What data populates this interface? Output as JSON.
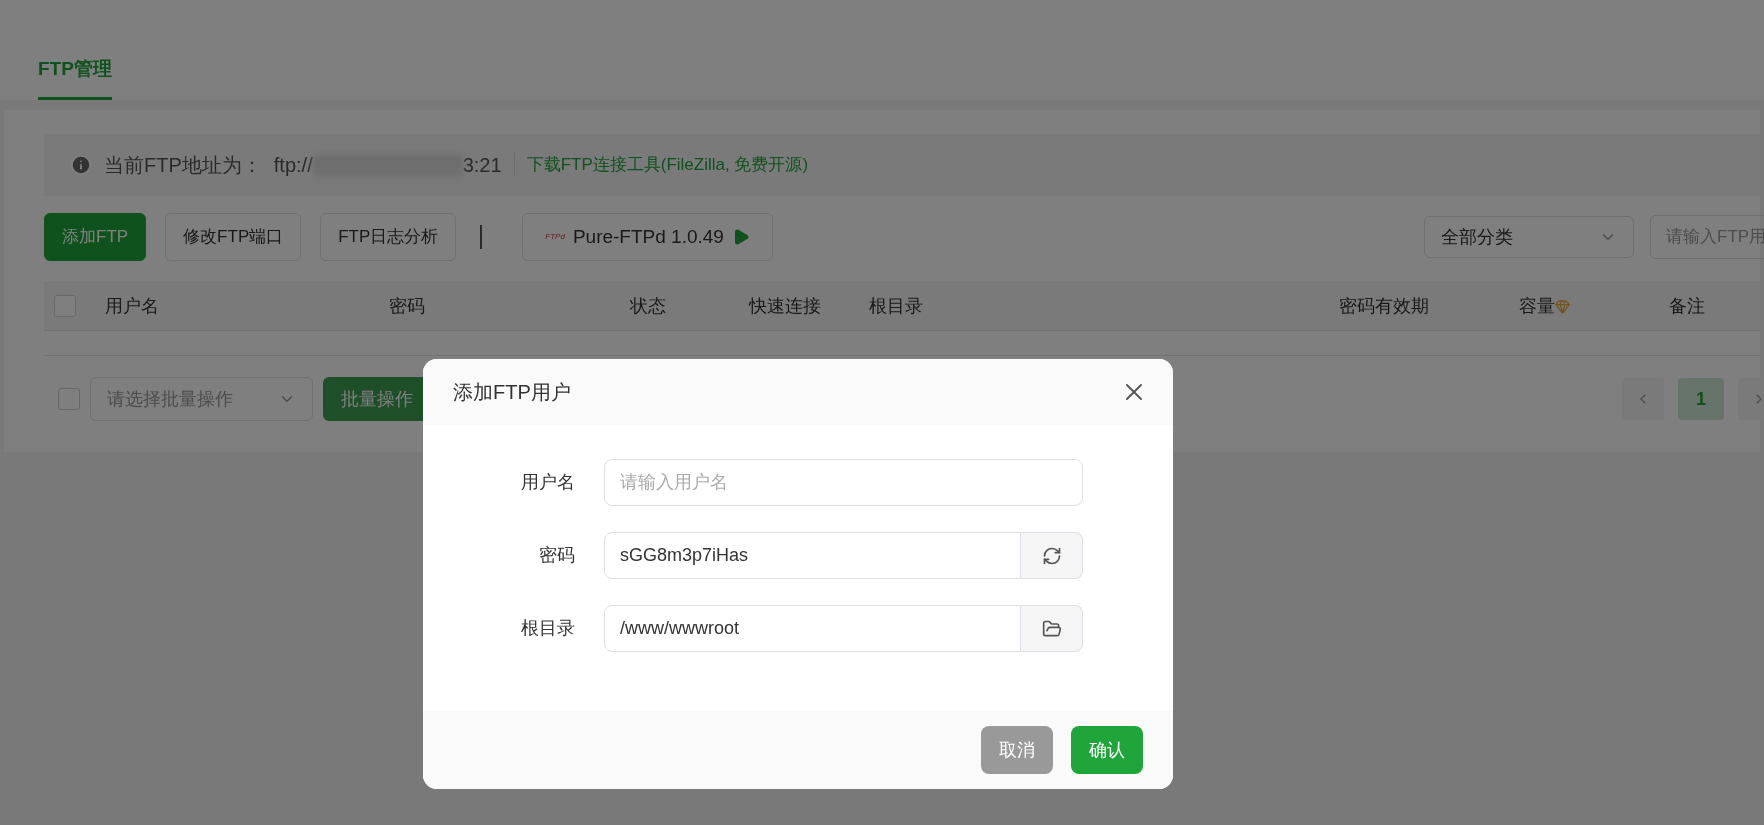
{
  "tab": {
    "label": "FTP管理",
    "selected": true
  },
  "info": {
    "label": "当前FTP地址为：",
    "address_prefix": "ftp://",
    "address_suffix": "3:21",
    "link": "下载FTP连接工具(FileZilla, 免费开源)"
  },
  "toolbar": {
    "buttons": [
      {
        "label": "添加FTP",
        "kind": "primary"
      },
      {
        "label": "修改FTP端口",
        "kind": "default"
      },
      {
        "label": "FTP日志分析",
        "kind": "default"
      }
    ],
    "service": {
      "logo": "FTPd",
      "label": "Pure-FTPd 1.0.49"
    },
    "category_select": {
      "value": "全部分类"
    },
    "search": {
      "placeholder": "请输入FTP用"
    }
  },
  "table": {
    "select_all": {
      "checked": false
    },
    "columns": [
      {
        "label": "用户名",
        "kind": "plain"
      },
      {
        "label": "密码",
        "kind": "plain"
      },
      {
        "label": "状态",
        "kind": "plain"
      },
      {
        "label": "快速连接",
        "kind": "plain"
      },
      {
        "label": "根目录",
        "kind": "plain"
      },
      {
        "label": "密码有效期",
        "kind": "plain"
      },
      {
        "label": "容量",
        "kind": "vip"
      },
      {
        "label": "备注",
        "kind": "plain"
      }
    ]
  },
  "footer": {
    "select_all": {
      "checked": false
    },
    "batch_select": {
      "placeholder": "请选择批量操作"
    },
    "batch_button": {
      "label": "批量操作",
      "disabled": true
    },
    "pagination": {
      "pages": [
        {
          "label": "1",
          "selected": true
        }
      ]
    }
  },
  "dialog": {
    "title": "添加FTP用户",
    "fields": [
      {
        "label": "用户名",
        "placeholder": "请输入用户名",
        "kind": "text"
      },
      {
        "label": "密码",
        "value": "sGG8m3p7iHas",
        "kind": "refresh"
      },
      {
        "label": "根目录",
        "value": "/www/wwwroot",
        "kind": "folder"
      }
    ],
    "buttons": [
      {
        "label": "取消",
        "kind": "cancel"
      },
      {
        "label": "确认",
        "kind": "confirm"
      }
    ]
  }
}
